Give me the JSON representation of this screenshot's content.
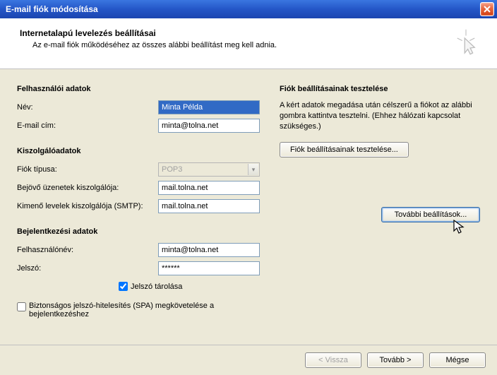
{
  "title": "E-mail fiók módosítása",
  "header": {
    "h": "Internetalapú levelezés beállításai",
    "sub": "Az e-mail fiók működéséhez az összes alábbi beállítást meg kell adnia."
  },
  "left": {
    "user_section": "Felhasználói adatok",
    "name_label": "Név:",
    "name_value": "Minta Példa",
    "email_label": "E-mail cím:",
    "email_value": "minta@tolna.net",
    "server_section": "Kiszolgálóadatok",
    "type_label": "Fiók típusa:",
    "type_value": "POP3",
    "incoming_label": "Bejövő üzenetek kiszolgálója:",
    "incoming_value": "mail.tolna.net",
    "outgoing_label": "Kimenő levelek kiszolgálója (SMTP):",
    "outgoing_value": "mail.tolna.net",
    "login_section": "Bejelentkezési adatok",
    "username_label": "Felhasználónév:",
    "username_value": "minta@tolna.net",
    "password_label": "Jelszó:",
    "password_value": "******",
    "remember_label": "Jelszó tárolása",
    "spa_label": "Biztonságos jelszó-hitelesítés (SPA) megkövetelése a bejelentkezéshez"
  },
  "right": {
    "test_section": "Fiók beállításainak tesztelése",
    "test_desc": "A kért adatok megadása után célszerű a fiókot az alábbi gombra kattintva tesztelni. (Ehhez hálózati kapcsolat szükséges.)",
    "test_button": "Fiók beállításainak tesztelése...",
    "more_button": "További beállítások..."
  },
  "footer": {
    "back": "< Vissza",
    "next": "Tovább >",
    "cancel": "Mégse"
  }
}
